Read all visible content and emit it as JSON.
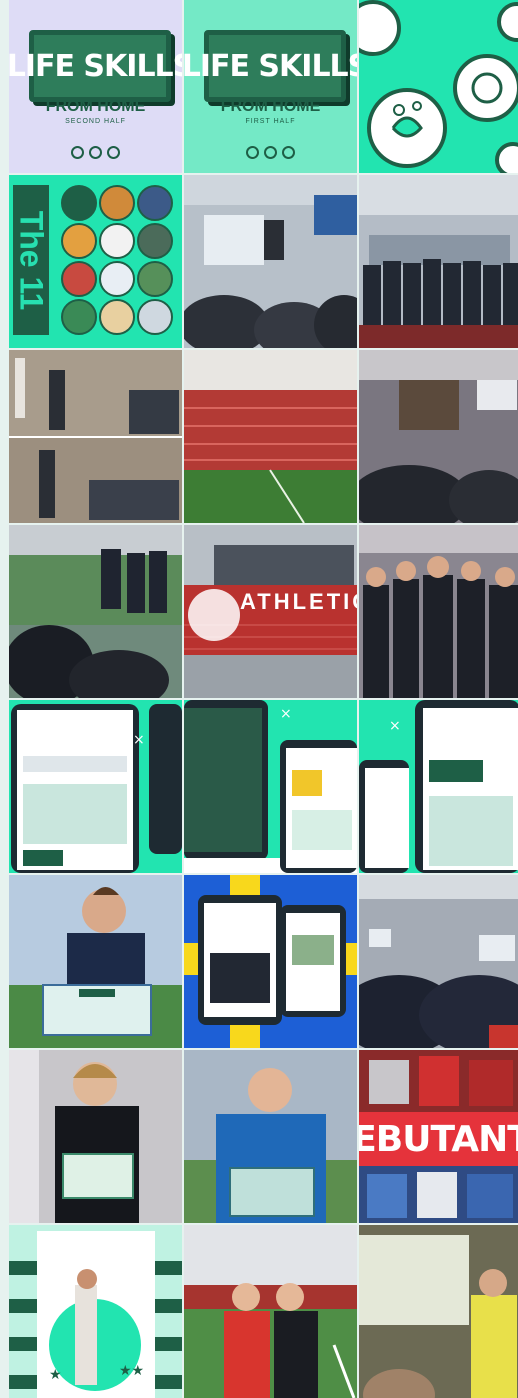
{
  "feed": {
    "tiles": [
      {
        "kind": "life-skills-second-half",
        "title": "LIFE SKILLS",
        "subtitle": "FROM HOME",
        "caption": "SECOND HALF",
        "bg": "#dedcf6"
      },
      {
        "kind": "life-skills-first-half",
        "title": "LIFE SKILLS",
        "subtitle": "FROM HOME",
        "caption": "FIRST HALF",
        "bg": "#74e9c6"
      },
      {
        "kind": "hygiene-icons",
        "bg": "#22e4b0"
      },
      {
        "kind": "the-11",
        "title": "The 11",
        "bg": "#22e4b0"
      },
      {
        "kind": "classroom-presentation",
        "bg": "#9aa3ad"
      },
      {
        "kind": "group-photo",
        "bg": "#6f7784"
      },
      {
        "kind": "presenter-collage",
        "bg": "#8a7c6c"
      },
      {
        "kind": "stadium",
        "bg": "#c24a43"
      },
      {
        "kind": "meeting-room",
        "bg": "#5a5a66"
      },
      {
        "kind": "pitchside-talk",
        "bg": "#3e5a4a"
      },
      {
        "kind": "athletic-stadium",
        "banner": "ATHLETIC",
        "bg": "#a8b0b8"
      },
      {
        "kind": "players-lineup",
        "bg": "#4c4c56"
      },
      {
        "kind": "website-tablet-1",
        "bg": "#22e4b0"
      },
      {
        "kind": "website-tablet-2",
        "bg": "#22e4b0"
      },
      {
        "kind": "website-tablet-3",
        "bg": "#22e4b0"
      },
      {
        "kind": "certificate-player-1",
        "bg": "#7fa2c4"
      },
      {
        "kind": "sweden-report-tablets",
        "bg": "#1d5fd6"
      },
      {
        "kind": "conference-hall",
        "bg": "#4a4e5c"
      },
      {
        "kind": "certificate-player-2",
        "bg": "#6c6a6e"
      },
      {
        "kind": "certificate-player-3",
        "bg": "#4f7aa4"
      },
      {
        "kind": "debutants",
        "title": "DEBUTANTS",
        "bg": "#2c2c36"
      },
      {
        "kind": "player-report-cover",
        "bg": "#bff2e2"
      },
      {
        "kind": "handshake-certificate",
        "bg": "#9c2b2b"
      },
      {
        "kind": "lecture-screen",
        "bg": "#5a5a3a"
      }
    ]
  }
}
